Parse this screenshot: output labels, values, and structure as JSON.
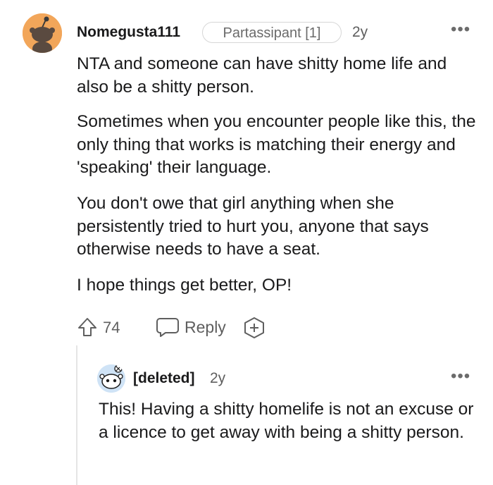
{
  "comment": {
    "username": "Nomegusta111",
    "flair": "Partassipant [1]",
    "time": "2y",
    "more_icon": "•••",
    "paragraphs": [
      "NTA and someone can have shitty home life and also be a shitty person.",
      "Sometimes when you encounter people like this, the only thing that works is matching their energy and 'speaking' their language.",
      "You don't owe that girl anything when she persistently tried to hurt you, anyone that says otherwise needs to have a seat.",
      "I hope things get better, OP!"
    ],
    "votes": "74",
    "reply_label": "Reply",
    "avatar_color": "#f2a65a"
  },
  "reply": {
    "username": "[deleted]",
    "time": "2y",
    "more_icon": "•••",
    "text": "This! Having a shitty homelife is not an excuse or a licence to get away with being a shitty person.",
    "avatar_color": "#cfe3f6"
  }
}
